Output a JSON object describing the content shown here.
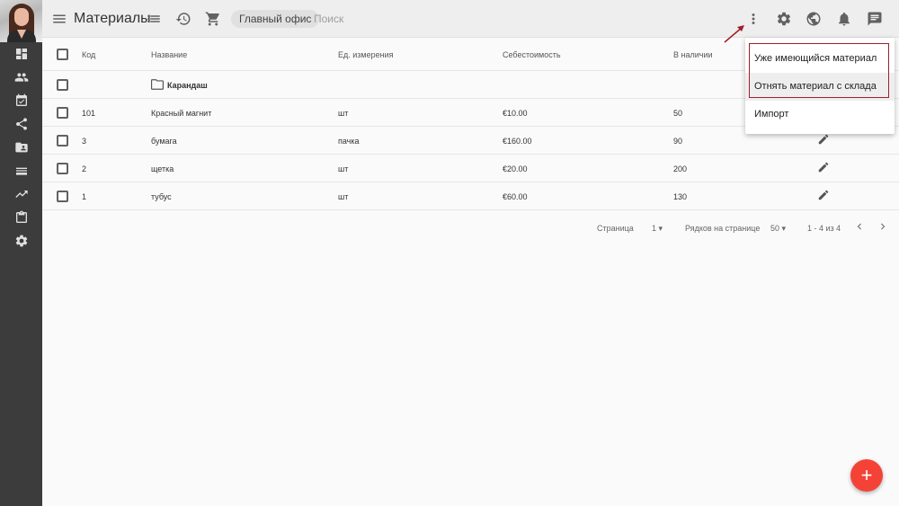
{
  "app": {
    "title": "Материалы"
  },
  "toolbar": {
    "office": "Главный офис",
    "search_placeholder": "Поиск"
  },
  "sidebar": {
    "items": [
      {
        "icon": "dashboard-icon"
      },
      {
        "icon": "people-icon"
      },
      {
        "icon": "event-check-icon"
      },
      {
        "icon": "share-icon"
      },
      {
        "icon": "folder-shared-icon"
      },
      {
        "icon": "list-icon"
      },
      {
        "icon": "trending-icon"
      },
      {
        "icon": "clipboard-icon"
      },
      {
        "icon": "settings-icon"
      }
    ]
  },
  "table": {
    "headers": {
      "code": "Код",
      "name": "Название",
      "unit": "Ед. измерения",
      "cost": "Себестоимость",
      "stock": "В наличии"
    },
    "folder": {
      "name": "Карандаш"
    },
    "rows": [
      {
        "code": "101",
        "name": "Красный магнит",
        "unit": "шт",
        "cost": "€10.00",
        "stock": "50"
      },
      {
        "code": "3",
        "name": "бумага",
        "unit": "пачка",
        "cost": "€160.00",
        "stock": "90"
      },
      {
        "code": "2",
        "name": "щетка",
        "unit": "шт",
        "cost": "€20.00",
        "stock": "200"
      },
      {
        "code": "1",
        "name": "тубус",
        "unit": "шт",
        "cost": "€60.00",
        "stock": "130"
      }
    ]
  },
  "pagination": {
    "page_label": "Страница",
    "page_value": "1",
    "rows_label": "Рядков на странице",
    "rows_value": "50",
    "range": "1 - 4 из 4"
  },
  "menu": {
    "items": [
      "Уже имеющийся материал",
      "Отнять материал с склада",
      "Импорт"
    ]
  },
  "colors": {
    "accent": "#f44336",
    "annotation": "#a01e2a",
    "sidebar": "#3c3c3c"
  }
}
